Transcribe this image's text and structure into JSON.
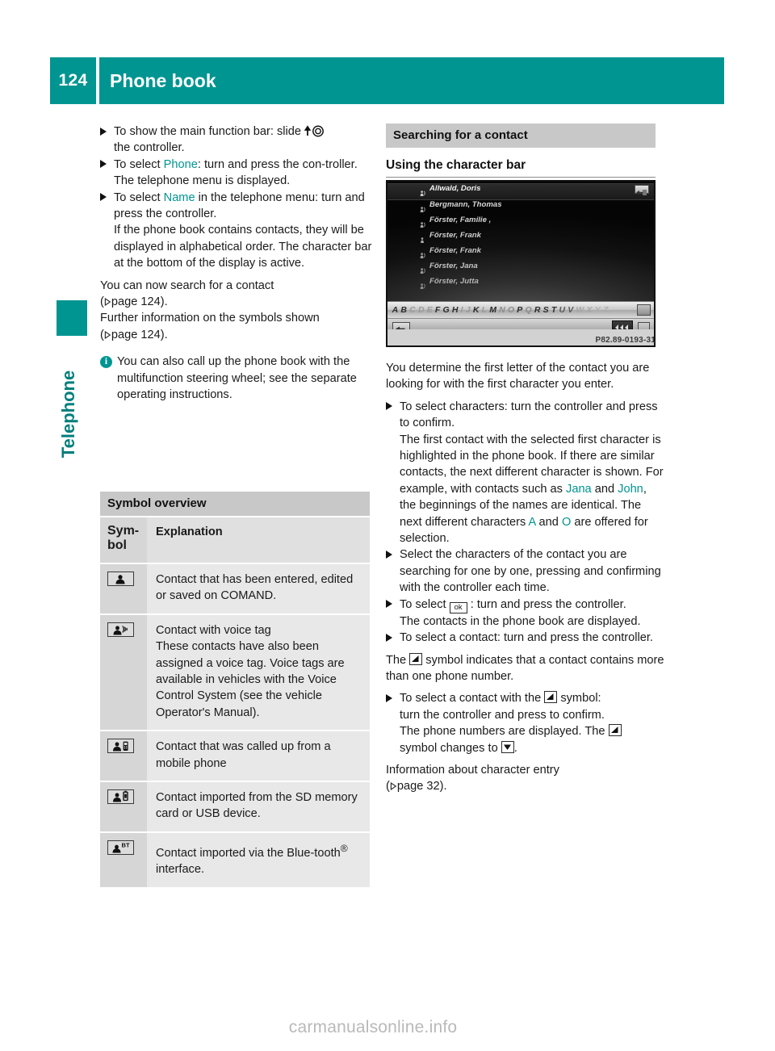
{
  "header": {
    "page_number": "124",
    "title": "Phone book",
    "accent_color": "#009591"
  },
  "side_tab": {
    "label": "Telephone"
  },
  "left_column": {
    "steps": [
      {
        "id": "show-main-function-bar",
        "text_before": "To show the main function bar: slide ",
        "icon": "controller-slide-up-icon",
        "text_after": "",
        "continuation": "the controller."
      },
      {
        "id": "select-phone",
        "text_before": "To select ",
        "highlight": "Phone",
        "text_after": ": turn and press the con-troller.",
        "note": "The telephone menu is displayed."
      },
      {
        "id": "select-name",
        "text_before": "To select ",
        "highlight": "Name",
        "text_after": " in the telephone menu: turn and press the controller.",
        "note": "If the phone book contains contacts, they will be displayed in alphabetical order. The character bar at the bottom of the display is active."
      }
    ],
    "ref_paragraphs": [
      {
        "text": "You can now search for a contact",
        "ref_prefix": "(",
        "ref": "page 124",
        "ref_suffix": ")."
      },
      {
        "text": "Further information on the symbols shown",
        "ref_prefix": "(",
        "ref": "page 124",
        "ref_suffix": ")."
      }
    ],
    "info_note": {
      "badge": "i",
      "text": "You can also call up the phone book with the multifunction steering wheel; see the separate operating instructions."
    }
  },
  "symbol_table": {
    "title": "Symbol overview",
    "columns": [
      "Sym-bol",
      "Explanation"
    ],
    "column_header_symbol": "Sym-",
    "column_header_symbol_2": "bol",
    "column_header_explanation": "Explanation",
    "rows": [
      {
        "icon": "contact-entered-icon",
        "text": "Contact that has been entered, edited or saved on COMAND."
      },
      {
        "icon": "contact-voice-tag-icon",
        "text": "Contact with voice tag",
        "text2": "These contacts have also been assigned a voice tag. Voice tags are available in vehicles with the Voice Control System (see the vehicle Operator's Manual)."
      },
      {
        "icon": "contact-mobile-phone-icon",
        "text": "Contact that was called up from a mobile phone"
      },
      {
        "icon": "contact-sd-usb-icon",
        "text": "Contact imported from the SD memory card or USB device."
      },
      {
        "icon": "contact-bluetooth-icon",
        "text_part1": "Contact imported via the Blue-tooth",
        "superscript": "®",
        "text_part2": " interface."
      }
    ]
  },
  "right_column": {
    "section_heading": "Searching for a contact",
    "sub_heading": "Using the character bar",
    "figure": {
      "caption": "P82.89-0193-31",
      "contacts": [
        {
          "name": "Allwald, Doris",
          "icon": "contact-voice-tag-icon",
          "selected": true
        },
        {
          "name": "Bergmann, Thomas",
          "icon": "contact-voice-tag-icon",
          "selected": false
        },
        {
          "name": "Förster, Familie ,",
          "icon": "contact-voice-tag-icon",
          "selected": false
        },
        {
          "name": "Förster, Frank",
          "icon": "contact-entered-icon",
          "selected": false
        },
        {
          "name": "Förster, Frank",
          "icon": "contact-voice-tag-icon",
          "selected": false
        },
        {
          "name": "Förster, Jana",
          "icon": "contact-voice-tag-icon",
          "selected": false
        },
        {
          "name": "Förster, Jutta",
          "icon": "contact-voice-tag-icon",
          "selected": false
        }
      ],
      "character_bar": "ABCDEFGHIJKLMNOPQRSTUVWXYZ",
      "character_bar_letters": [
        "A",
        "B",
        "C",
        "D",
        "E",
        "F",
        "G",
        "H",
        "I",
        "J",
        "K",
        "L",
        "M",
        "N",
        "O",
        "P",
        "Q",
        "R",
        "S",
        "T",
        "U",
        "V",
        "W",
        "X",
        "Y",
        "Z"
      ],
      "character_bar_active": [
        "A",
        "B",
        "F",
        "G",
        "H",
        "K",
        "M",
        "P",
        "R",
        "S",
        "T",
        "U",
        "V"
      ]
    },
    "intro": "You determine the first letter of the contact you are looking for with the first character you enter.",
    "steps": [
      {
        "id": "select-characters",
        "text": "To select characters: turn the controller and press to confirm.",
        "note_a": "The first contact with the selected first character is highlighted in the phone book. If there are similar contacts, the next different character is shown. For example, with contacts such as ",
        "hl1": "Jana",
        "note_b": " and ",
        "hl2": "John",
        "note_c": ", the beginnings of the names are identical. The next different characters ",
        "hl3": "A",
        "note_d": " and ",
        "hl4": "O",
        "note_e": " are offered for selection."
      },
      {
        "id": "select-one-by-one",
        "text": "Select the characters of the contact you are searching for one by one, pressing and confirming with the controller each time."
      },
      {
        "id": "select-ok",
        "text_before": "To select ",
        "icon": "ok-button-icon",
        "icon_label": "ok",
        "text_after": " : turn and press the controller.",
        "note": "The contacts in the phone book are displayed."
      },
      {
        "id": "select-contact",
        "text": "To select a contact: turn and press the controller."
      }
    ],
    "symbol_note": {
      "text_before": "The ",
      "icon": "triangle-collapsed-icon",
      "text_after": " symbol indicates that a contact contains more than one phone number."
    },
    "final_step": {
      "id": "select-contact-with-symbol",
      "text_before": "To select a contact with the ",
      "icon": "triangle-collapsed-icon",
      "text_after": " symbol:",
      "note_a": "turn the controller and press to confirm.",
      "note_b": "The phone numbers are displayed. The ",
      "icon2": "triangle-collapsed-icon",
      "note_c": "symbol changes to ",
      "icon3": "triangle-expanded-icon",
      "note_d": "."
    },
    "closing": {
      "text": "Information about character entry",
      "ref_prefix": "(",
      "ref": "page 32",
      "ref_suffix": ")."
    }
  },
  "watermark": "carmanualsonline.info"
}
